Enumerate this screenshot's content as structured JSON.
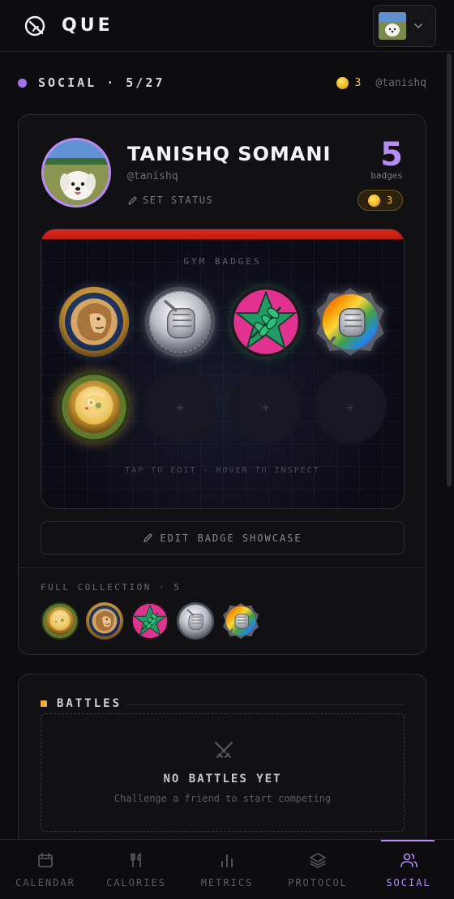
{
  "app": {
    "name": "QUE"
  },
  "section": {
    "title": "SOCIAL · 5/27",
    "coins": "3",
    "handle": "@tanishq"
  },
  "profile": {
    "name": "TANISHQ SOMANI",
    "handle": "@tanishq",
    "set_status": "SET STATUS",
    "badge_count": "5",
    "badge_count_label": "badges",
    "coins": "3"
  },
  "showcase": {
    "title": "GYM BADGES",
    "hint": "TAP TO EDIT · HOVER TO INSPECT",
    "empty_slot_symbol": "+",
    "slots": [
      "lion-badge",
      "fist-chain-badge",
      "star-leaf-badge",
      "rainbow-fist-badge",
      "biryani-badge",
      "empty",
      "empty",
      "empty"
    ],
    "edit_label": "EDIT BADGE SHOWCASE"
  },
  "collection": {
    "label": "FULL COLLECTION · 5",
    "items": [
      "biryani-badge",
      "lion-badge",
      "star-leaf-badge",
      "fist-chain-badge",
      "rainbow-fist-badge"
    ]
  },
  "battles": {
    "title": "BATTLES",
    "empty_title": "NO BATTLES YET",
    "empty_subtitle": "Challenge a friend to start competing"
  },
  "nav": {
    "items": [
      {
        "label": "CALENDAR",
        "icon": "calendar-icon"
      },
      {
        "label": "CALORIES",
        "icon": "utensils-icon"
      },
      {
        "label": "METRICS",
        "icon": "bar-chart-icon"
      },
      {
        "label": "PROTOCOL",
        "icon": "layers-icon"
      },
      {
        "label": "SOCIAL",
        "icon": "users-icon"
      }
    ],
    "active": "SOCIAL"
  },
  "colors": {
    "accent": "#b68cf5",
    "gold": "#f5c542",
    "stripe": "#e02818"
  }
}
